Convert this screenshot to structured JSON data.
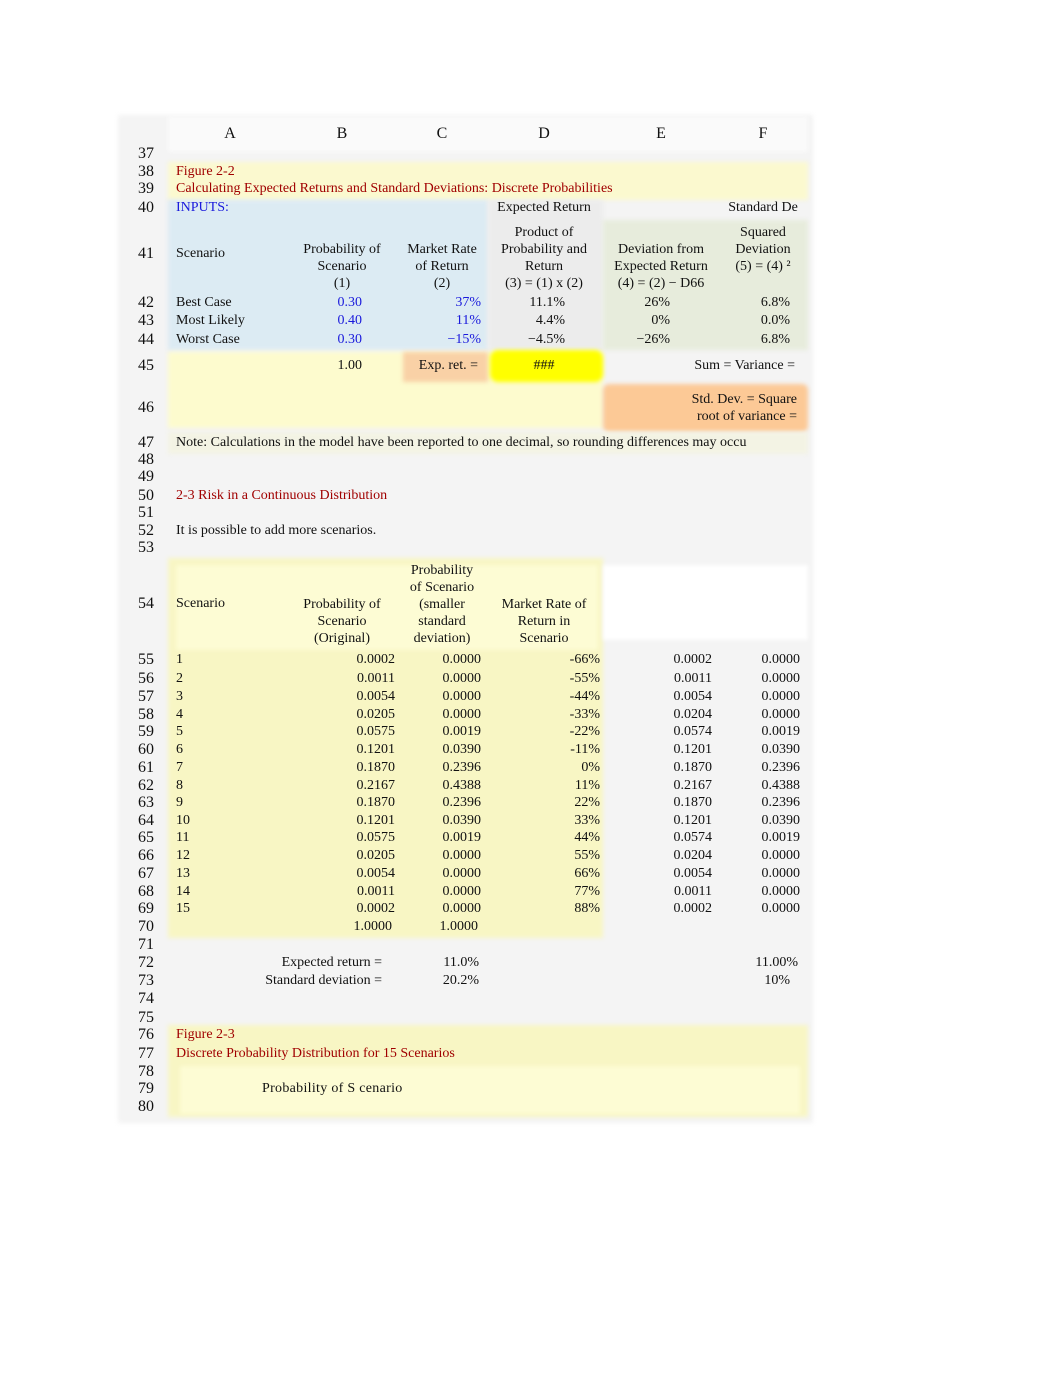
{
  "columns": [
    "A",
    "B",
    "C",
    "D",
    "E",
    "F"
  ],
  "colors": {
    "title_red": "#a00000",
    "input_blue": "#1a1adc",
    "highlight_yellow": "#ffff00",
    "orange": "#fcd0a0",
    "input_bg": "#dcebf3",
    "yellow_bg": "#fdfbd0"
  },
  "rows": [
    {
      "n": "37",
      "cells": []
    },
    {
      "n": "38",
      "cells": [
        {
          "col": "A",
          "text": "Figure 2-2",
          "align": "left",
          "color": "#a00000"
        }
      ]
    },
    {
      "n": "39",
      "cells": [
        {
          "col": "A",
          "text": "Calculating Expected Returns and Standard Deviations: Discrete Probabilities",
          "align": "left",
          "color": "#a00000"
        }
      ]
    },
    {
      "n": "40",
      "cells": [
        {
          "col": "A",
          "text": "INPUTS:",
          "align": "left",
          "color": "#1a1adc"
        },
        {
          "col": "D",
          "text": "Expected Return",
          "align": "center"
        },
        {
          "col": "F",
          "text": "Standard De",
          "align": "center"
        }
      ]
    },
    {
      "n": "41",
      "cells": [
        {
          "col": "A",
          "text": "Scenario",
          "align": "left"
        },
        {
          "col": "B",
          "text": "Probability of\nScenario\n(1)",
          "align": "center"
        },
        {
          "col": "C",
          "text": "Market Rate\nof Return\n(2)",
          "align": "center"
        },
        {
          "col": "D",
          "text": "Product of\nProbability and\nReturn\n(3) = (1) x (2)",
          "align": "center"
        },
        {
          "col": "E",
          "text": "Deviation from\nExpected Return\n(4) = (2) − D66",
          "align": "center"
        },
        {
          "col": "F",
          "text": "Squared\nDeviation\n(5) = (4) ²\n ",
          "align": "center"
        }
      ]
    },
    {
      "n": "42",
      "cells": [
        {
          "col": "A",
          "text": "Best Case",
          "align": "left"
        },
        {
          "col": "B",
          "text": "0.30",
          "align": "rightB",
          "color": "#1a1adc"
        },
        {
          "col": "C",
          "text": "37%",
          "align": "right",
          "color": "#1a1adc"
        },
        {
          "col": "D",
          "text": "11.1%",
          "align": "rightD"
        },
        {
          "col": "E",
          "text": "26%",
          "align": "rightE"
        },
        {
          "col": "F",
          "text": "6.8%",
          "align": "rightF"
        }
      ]
    },
    {
      "n": "43",
      "cells": [
        {
          "col": "A",
          "text": "Most Likely",
          "align": "left"
        },
        {
          "col": "B",
          "text": "0.40",
          "align": "rightB",
          "color": "#1a1adc"
        },
        {
          "col": "C",
          "text": "11%",
          "align": "right",
          "color": "#1a1adc"
        },
        {
          "col": "D",
          "text": "4.4%",
          "align": "rightD"
        },
        {
          "col": "E",
          "text": "0%",
          "align": "rightE"
        },
        {
          "col": "F",
          "text": "0.0%",
          "align": "rightF"
        }
      ]
    },
    {
      "n": "44",
      "cells": [
        {
          "col": "A",
          "text": "Worst Case",
          "align": "left"
        },
        {
          "col": "B",
          "text": "0.30",
          "align": "rightB",
          "color": "#1a1adc"
        },
        {
          "col": "C",
          "text": "−15%",
          "align": "right",
          "color": "#1a1adc"
        },
        {
          "col": "D",
          "text": "−4.5%",
          "align": "rightD"
        },
        {
          "col": "E",
          "text": "−26%",
          "align": "rightE"
        },
        {
          "col": "F",
          "text": "6.8%",
          "align": "rightF"
        }
      ]
    },
    {
      "n": "45",
      "cells": [
        {
          "col": "B",
          "text": "1.00",
          "align": "rightB"
        },
        {
          "col": "C",
          "text": "Exp. ret. =",
          "align": "right"
        },
        {
          "col": "D",
          "text": "###",
          "align": "center"
        },
        {
          "col": "F",
          "text": "Sum = Variance =",
          "align": "right"
        }
      ]
    },
    {
      "n": "46",
      "cells": [
        {
          "col": "F",
          "text": "Std. Dev. = Square\nroot of variance =",
          "align": "right"
        }
      ]
    },
    {
      "n": "47",
      "cells": [
        {
          "col": "A",
          "text": "Note: Calculations in the model have been reported to one decimal, so rounding differences may occu",
          "align": "left"
        }
      ]
    },
    {
      "n": "48",
      "cells": []
    },
    {
      "n": "49",
      "cells": []
    },
    {
      "n": "50",
      "cells": [
        {
          "col": "A",
          "text": "2-3 Risk in a Continuous Distribution",
          "align": "left",
          "color": "#a00000"
        }
      ]
    },
    {
      "n": "51",
      "cells": []
    },
    {
      "n": "52",
      "cells": [
        {
          "col": "A",
          "text": "It is possible to add more scenarios.",
          "align": "left"
        }
      ]
    },
    {
      "n": "53",
      "cells": []
    },
    {
      "n": "54",
      "cells": [
        {
          "col": "A",
          "text": "Scenario",
          "align": "leftmid"
        },
        {
          "col": "B",
          "text": "Probability of\nScenario\n(Original)",
          "align": "center"
        },
        {
          "col": "C",
          "text": "Probability\nof Scenario\n(smaller\nstandard\ndeviation)",
          "align": "center"
        },
        {
          "col": "D",
          "text": "Market Rate of\nReturn in\nScenario",
          "align": "center"
        }
      ]
    },
    {
      "n": "55",
      "cells": [
        {
          "col": "A",
          "text": "1",
          "align": "left"
        },
        {
          "col": "B",
          "text": "0.0002",
          "align": "right"
        },
        {
          "col": "C",
          "text": "0.0000",
          "align": "right"
        },
        {
          "col": "D",
          "text": "-66%",
          "align": "right"
        },
        {
          "col": "E",
          "text": "0.0002",
          "align": "right"
        },
        {
          "col": "F",
          "text": "0.0000",
          "align": "right"
        }
      ]
    },
    {
      "n": "56",
      "cells": [
        {
          "col": "A",
          "text": "2",
          "align": "left"
        },
        {
          "col": "B",
          "text": "0.0011",
          "align": "right"
        },
        {
          "col": "C",
          "text": "0.0000",
          "align": "right"
        },
        {
          "col": "D",
          "text": "-55%",
          "align": "right"
        },
        {
          "col": "E",
          "text": "0.0011",
          "align": "right"
        },
        {
          "col": "F",
          "text": "0.0000",
          "align": "right"
        }
      ]
    },
    {
      "n": "57",
      "cells": [
        {
          "col": "A",
          "text": "3",
          "align": "left"
        },
        {
          "col": "B",
          "text": "0.0054",
          "align": "right"
        },
        {
          "col": "C",
          "text": "0.0000",
          "align": "right"
        },
        {
          "col": "D",
          "text": "-44%",
          "align": "right"
        },
        {
          "col": "E",
          "text": "0.0054",
          "align": "right"
        },
        {
          "col": "F",
          "text": "0.0000",
          "align": "right"
        }
      ]
    },
    {
      "n": "58",
      "cells": [
        {
          "col": "A",
          "text": "4",
          "align": "left"
        },
        {
          "col": "B",
          "text": "0.0205",
          "align": "right"
        },
        {
          "col": "C",
          "text": "0.0000",
          "align": "right"
        },
        {
          "col": "D",
          "text": "-33%",
          "align": "right"
        },
        {
          "col": "E",
          "text": "0.0204",
          "align": "right"
        },
        {
          "col": "F",
          "text": "0.0000",
          "align": "right"
        }
      ]
    },
    {
      "n": "59",
      "cells": [
        {
          "col": "A",
          "text": "5",
          "align": "left"
        },
        {
          "col": "B",
          "text": "0.0575",
          "align": "right"
        },
        {
          "col": "C",
          "text": "0.0019",
          "align": "right"
        },
        {
          "col": "D",
          "text": "-22%",
          "align": "right"
        },
        {
          "col": "E",
          "text": "0.0574",
          "align": "right"
        },
        {
          "col": "F",
          "text": "0.0019",
          "align": "right"
        }
      ]
    },
    {
      "n": "60",
      "cells": [
        {
          "col": "A",
          "text": "6",
          "align": "left"
        },
        {
          "col": "B",
          "text": "0.1201",
          "align": "right"
        },
        {
          "col": "C",
          "text": "0.0390",
          "align": "right"
        },
        {
          "col": "D",
          "text": "-11%",
          "align": "right"
        },
        {
          "col": "E",
          "text": "0.1201",
          "align": "right"
        },
        {
          "col": "F",
          "text": "0.0390",
          "align": "right"
        }
      ]
    },
    {
      "n": "61",
      "cells": [
        {
          "col": "A",
          "text": "7",
          "align": "left"
        },
        {
          "col": "B",
          "text": "0.1870",
          "align": "right"
        },
        {
          "col": "C",
          "text": "0.2396",
          "align": "right"
        },
        {
          "col": "D",
          "text": "0%",
          "align": "right"
        },
        {
          "col": "E",
          "text": "0.1870",
          "align": "right"
        },
        {
          "col": "F",
          "text": "0.2396",
          "align": "right"
        }
      ]
    },
    {
      "n": "62",
      "cells": [
        {
          "col": "A",
          "text": "8",
          "align": "left"
        },
        {
          "col": "B",
          "text": "0.2167",
          "align": "right"
        },
        {
          "col": "C",
          "text": "0.4388",
          "align": "right"
        },
        {
          "col": "D",
          "text": "11%",
          "align": "right"
        },
        {
          "col": "E",
          "text": "0.2167",
          "align": "right"
        },
        {
          "col": "F",
          "text": "0.4388",
          "align": "right"
        }
      ]
    },
    {
      "n": "63",
      "cells": [
        {
          "col": "A",
          "text": "9",
          "align": "left"
        },
        {
          "col": "B",
          "text": "0.1870",
          "align": "right"
        },
        {
          "col": "C",
          "text": "0.2396",
          "align": "right"
        },
        {
          "col": "D",
          "text": "22%",
          "align": "right"
        },
        {
          "col": "E",
          "text": "0.1870",
          "align": "right"
        },
        {
          "col": "F",
          "text": "0.2396",
          "align": "right"
        }
      ]
    },
    {
      "n": "64",
      "cells": [
        {
          "col": "A",
          "text": "10",
          "align": "left"
        },
        {
          "col": "B",
          "text": "0.1201",
          "align": "right"
        },
        {
          "col": "C",
          "text": "0.0390",
          "align": "right"
        },
        {
          "col": "D",
          "text": "33%",
          "align": "right"
        },
        {
          "col": "E",
          "text": "0.1201",
          "align": "right"
        },
        {
          "col": "F",
          "text": "0.0390",
          "align": "right"
        }
      ]
    },
    {
      "n": "65",
      "cells": [
        {
          "col": "A",
          "text": "11",
          "align": "left"
        },
        {
          "col": "B",
          "text": "0.0575",
          "align": "right"
        },
        {
          "col": "C",
          "text": "0.0019",
          "align": "right"
        },
        {
          "col": "D",
          "text": "44%",
          "align": "right"
        },
        {
          "col": "E",
          "text": "0.0574",
          "align": "right"
        },
        {
          "col": "F",
          "text": "0.0019",
          "align": "right"
        }
      ]
    },
    {
      "n": "66",
      "cells": [
        {
          "col": "A",
          "text": "12",
          "align": "left"
        },
        {
          "col": "B",
          "text": "0.0205",
          "align": "right"
        },
        {
          "col": "C",
          "text": "0.0000",
          "align": "right"
        },
        {
          "col": "D",
          "text": "55%",
          "align": "right"
        },
        {
          "col": "E",
          "text": "0.0204",
          "align": "right"
        },
        {
          "col": "F",
          "text": "0.0000",
          "align": "right"
        }
      ]
    },
    {
      "n": "67",
      "cells": [
        {
          "col": "A",
          "text": "13",
          "align": "left"
        },
        {
          "col": "B",
          "text": "0.0054",
          "align": "right"
        },
        {
          "col": "C",
          "text": "0.0000",
          "align": "right"
        },
        {
          "col": "D",
          "text": "66%",
          "align": "right"
        },
        {
          "col": "E",
          "text": "0.0054",
          "align": "right"
        },
        {
          "col": "F",
          "text": "0.0000",
          "align": "right"
        }
      ]
    },
    {
      "n": "68",
      "cells": [
        {
          "col": "A",
          "text": "14",
          "align": "left"
        },
        {
          "col": "B",
          "text": "0.0011",
          "align": "right"
        },
        {
          "col": "C",
          "text": "0.0000",
          "align": "right"
        },
        {
          "col": "D",
          "text": "77%",
          "align": "right"
        },
        {
          "col": "E",
          "text": "0.0011",
          "align": "right"
        },
        {
          "col": "F",
          "text": "0.0000",
          "align": "right"
        }
      ]
    },
    {
      "n": "69",
      "cells": [
        {
          "col": "A",
          "text": "15",
          "align": "left"
        },
        {
          "col": "B",
          "text": "0.0002",
          "align": "right"
        },
        {
          "col": "C",
          "text": "0.0000",
          "align": "right"
        },
        {
          "col": "D",
          "text": "88%",
          "align": "right"
        },
        {
          "col": "E",
          "text": "0.0002",
          "align": "right"
        },
        {
          "col": "F",
          "text": "0.0000",
          "align": "right"
        }
      ]
    },
    {
      "n": "70",
      "cells": [
        {
          "col": "B",
          "text": "1.0000",
          "align": "rightTot"
        },
        {
          "col": "C",
          "text": "1.0000",
          "align": "rightTot"
        }
      ]
    },
    {
      "n": "71",
      "cells": []
    },
    {
      "n": "72",
      "cells": [
        {
          "col": "B",
          "text": "Expected return =",
          "align": "rightLbl"
        },
        {
          "col": "C",
          "text": "11.0%",
          "align": "rightLbl"
        },
        {
          "col": "F",
          "text": "11.00%",
          "align": "rightF"
        }
      ]
    },
    {
      "n": "73",
      "cells": [
        {
          "col": "B",
          "text": "Standard deviation =",
          "align": "rightLbl"
        },
        {
          "col": "C",
          "text": "20.2%",
          "align": "rightLbl"
        },
        {
          "col": "F",
          "text": "10%",
          "align": "rightF"
        }
      ]
    },
    {
      "n": "74",
      "cells": []
    },
    {
      "n": "75",
      "cells": []
    },
    {
      "n": "76",
      "cells": [
        {
          "col": "A",
          "text": "Figure 2-3",
          "align": "left",
          "color": "#a00000"
        }
      ]
    },
    {
      "n": "77",
      "cells": [
        {
          "col": "A",
          "text": "Discrete Probability Distribution for 15 Scenarios",
          "align": "left",
          "color": "#a00000"
        }
      ]
    },
    {
      "n": "78",
      "cells": []
    },
    {
      "n": "79",
      "cells": [
        {
          "col": "B",
          "text": "Probability of S cenario",
          "align": "chart"
        }
      ]
    },
    {
      "n": "80",
      "cells": []
    }
  ]
}
